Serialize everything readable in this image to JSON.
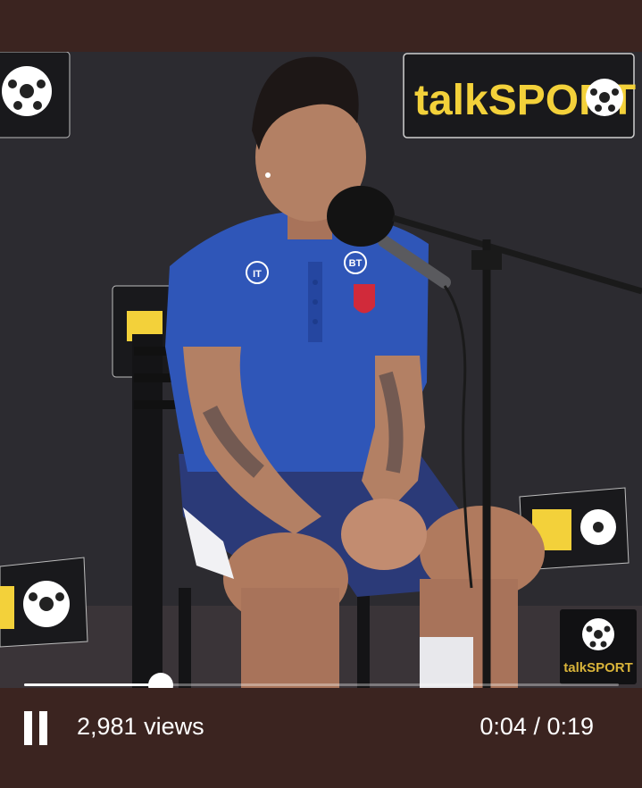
{
  "video": {
    "description_scene": "talkSPORT interview",
    "brand_text": "talkSPORT",
    "mic_label": "talkSPORT",
    "shirt_badges": [
      "IT",
      "BT"
    ]
  },
  "player": {
    "views_text": "2,981 views",
    "current_time": "0:04",
    "duration": "0:19",
    "time_text": "0:04 / 0:19",
    "progress_fraction": 0.23,
    "state": "playing"
  },
  "icons": {
    "pause": "pause-icon",
    "watermark": "talksport-watermark-icon"
  },
  "colors": {
    "bar_bg": "#3b2420",
    "brand_yellow": "#f3d13a",
    "shirt_blue": "#2f56b8"
  }
}
